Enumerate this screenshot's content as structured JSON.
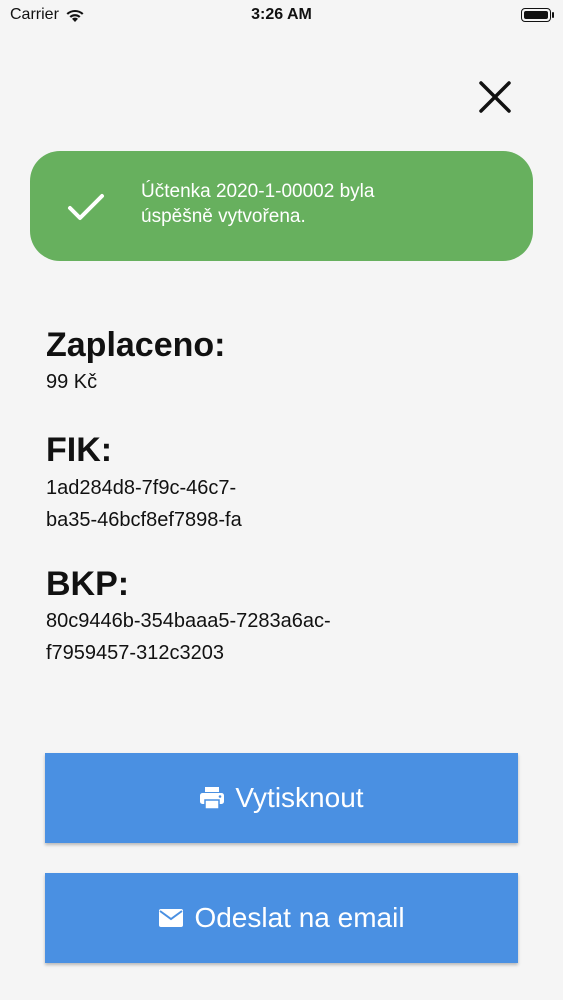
{
  "status_bar": {
    "carrier": "Carrier",
    "time": "3:26 AM"
  },
  "toast": {
    "message_line1": "Účtenka 2020-1-00002 byla",
    "message_line2": "úspěšně vytvořena.",
    "color": "#67b05e"
  },
  "paid": {
    "title": "Zaplaceno:",
    "value": "99 Kč"
  },
  "fik": {
    "title": "FIK:",
    "value_line1": "1ad284d8-7f9c-46c7-",
    "value_line2": "ba35-46bcf8ef7898-fa"
  },
  "bkp": {
    "title": "BKP:",
    "value_line1": "80c9446b-354baaa5-7283a6ac-",
    "value_line2": "f7959457-312c3203"
  },
  "actions": {
    "print_label": "Vytisknout",
    "email_label": "Odeslat na email",
    "accent": "#4a90e2"
  }
}
